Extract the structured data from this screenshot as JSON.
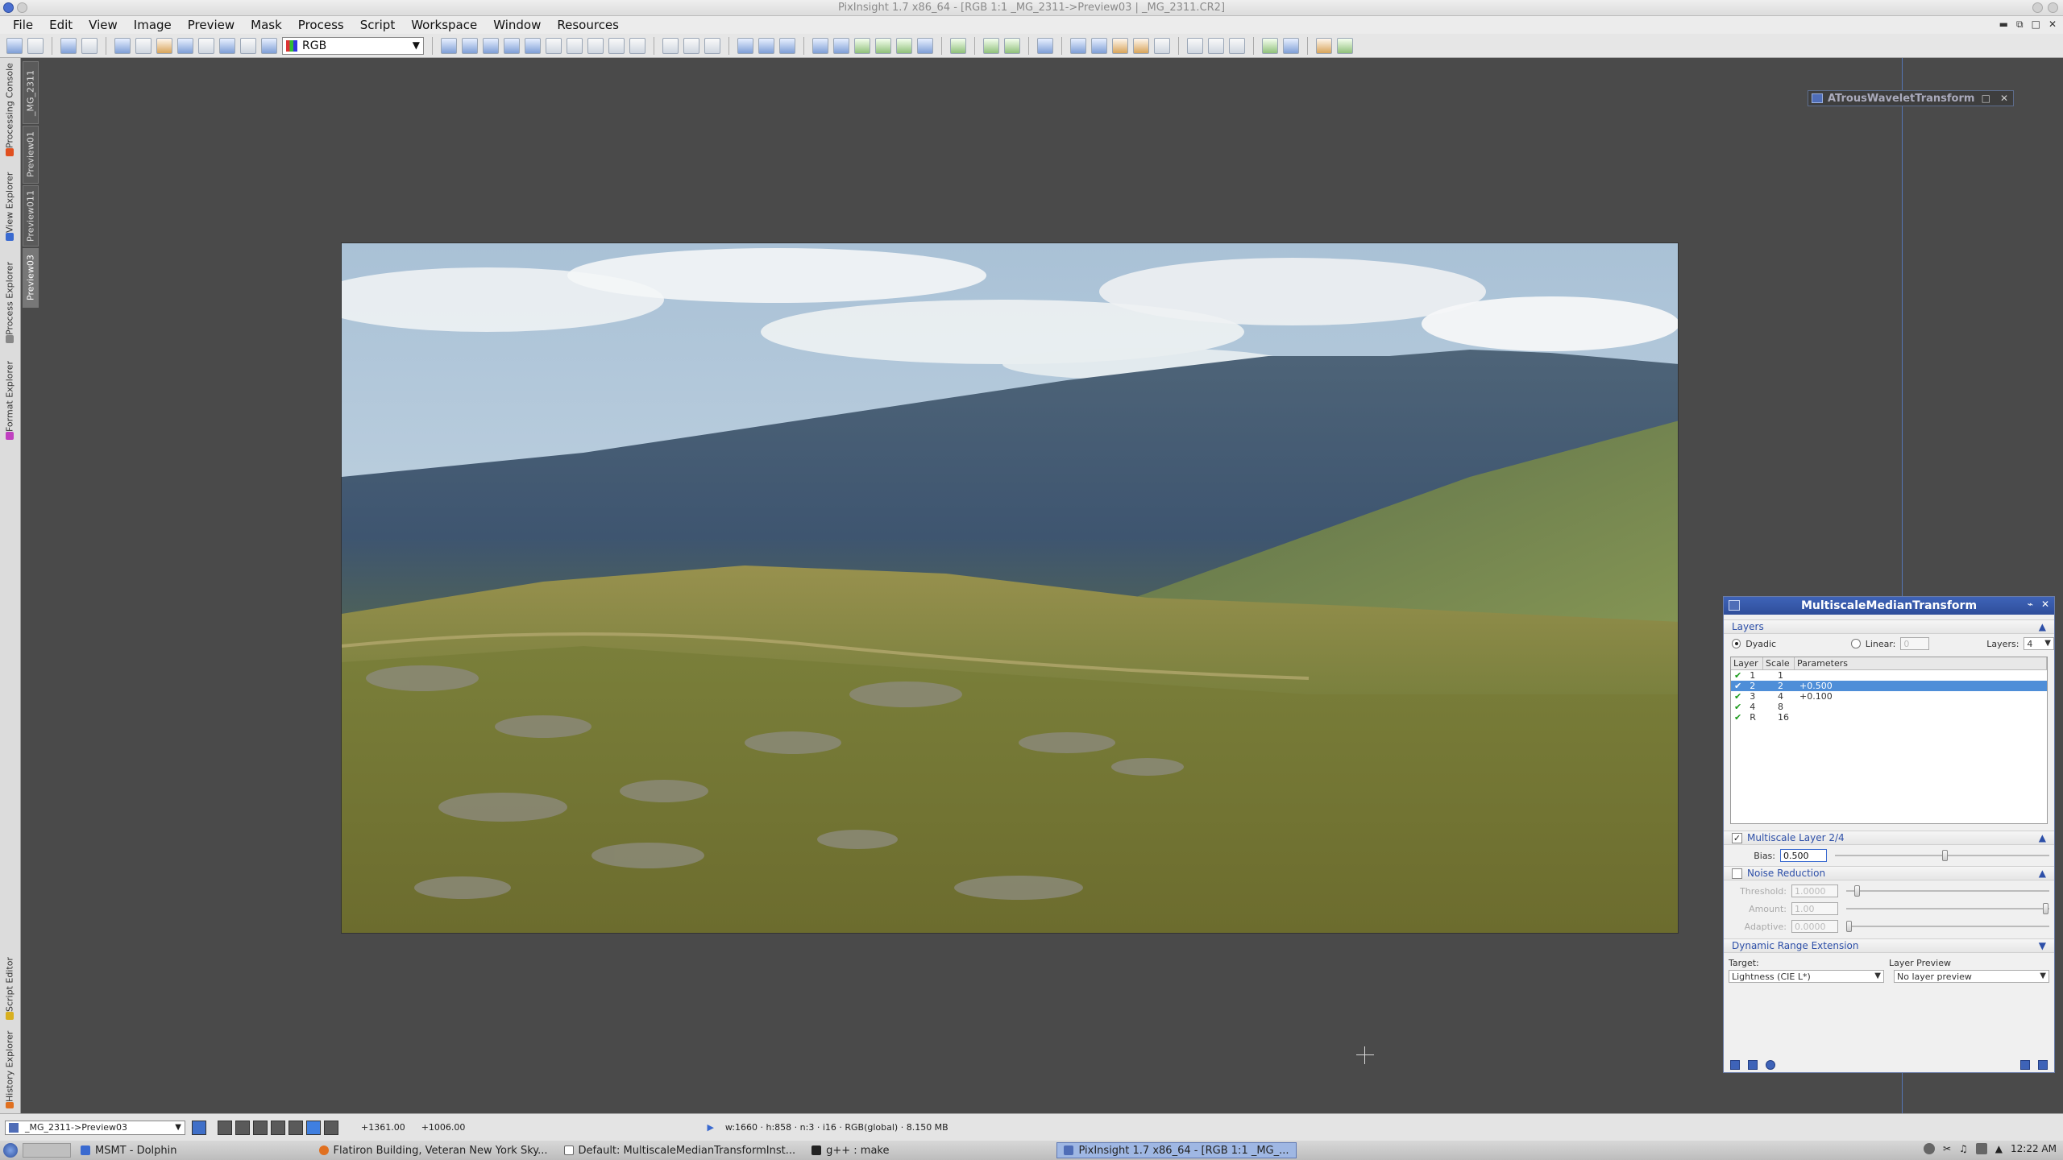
{
  "window": {
    "title": "PixInsight 1.7 x86_64 - [RGB 1:1 _MG_2311->Preview03 | _MG_2311.CR2]"
  },
  "menu": [
    "File",
    "Edit",
    "View",
    "Image",
    "Preview",
    "Mask",
    "Process",
    "Script",
    "Workspace",
    "Window",
    "Resources"
  ],
  "toolbar": {
    "channel_select": "RGB"
  },
  "left_tabs": {
    "processing_console": "Processing Console",
    "view_explorer": "View Explorer",
    "process_explorer": "Process Explorer",
    "format_explorer": "Format Explorer",
    "script_editor": "Script Editor",
    "history_explorer": "History Explorer"
  },
  "view_tabs": [
    "_MG_2311",
    "Preview01",
    "Preview011",
    "Preview03"
  ],
  "iconified_process": {
    "label": "ATrousWaveletTransform"
  },
  "mmt": {
    "title": "MultiscaleMedianTransform",
    "layers_section": "Layers",
    "dyadic_label": "Dyadic",
    "linear_label": "Linear:",
    "linear_value": "0",
    "layers_label": "Layers:",
    "layers_value": "4",
    "columns": [
      "Layer",
      "Scale",
      "Parameters"
    ],
    "rows": [
      {
        "layer": "1",
        "scale": "1",
        "params": "",
        "selected": false
      },
      {
        "layer": "2",
        "scale": "2",
        "params": "+0.500",
        "selected": true
      },
      {
        "layer": "3",
        "scale": "4",
        "params": "+0.100",
        "selected": false
      },
      {
        "layer": "4",
        "scale": "8",
        "params": "",
        "selected": false
      },
      {
        "layer": "R",
        "scale": "16",
        "params": "",
        "selected": false
      }
    ],
    "multiscale_layer_section": "Multiscale Layer 2/4",
    "bias_label": "Bias:",
    "bias_value": "0.500",
    "bias_slider": 0.5,
    "noise_reduction_section": "Noise Reduction",
    "threshold_label": "Threshold:",
    "threshold_value": "1.0000",
    "amount_label": "Amount:",
    "amount_value": "1.00",
    "adaptive_label": "Adaptive:",
    "adaptive_value": "0.0000",
    "dre_section": "Dynamic Range Extension",
    "target_label": "Target:",
    "target_value": "Lightness (CIE L*)",
    "layer_preview_label": "Layer Preview",
    "layer_preview_value": "No layer preview"
  },
  "statusbar": {
    "view": "_MG_2311->Preview03",
    "coord_x": "+1361.00",
    "coord_y": "+1006.00",
    "info": "w:1660 · h:858 · n:3 · i16 · RGB(global) · 8.150 MB"
  },
  "taskbar": {
    "tasks": [
      {
        "label": "MSMT - Dolphin",
        "active": false
      },
      {
        "label": "Flatiron Building, Veteran New York Sky...",
        "active": false
      },
      {
        "label": "Default: MultiscaleMedianTransformInst...",
        "active": false
      },
      {
        "label": "g++ : make",
        "active": false
      },
      {
        "label": "PixInsight 1.7 x86_64 - [RGB 1:1 _MG_...",
        "active": true
      }
    ],
    "clock": "12:22 AM"
  }
}
